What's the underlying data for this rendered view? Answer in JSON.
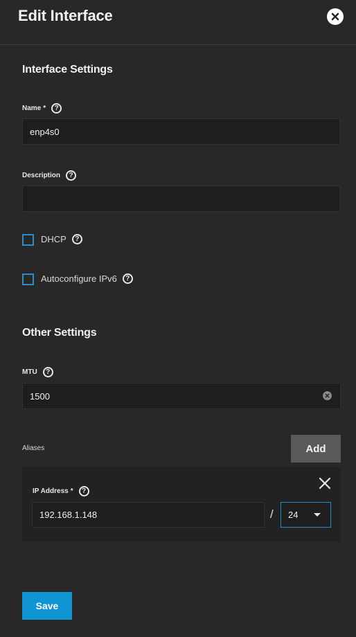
{
  "dialog": {
    "title": "Edit Interface"
  },
  "interface_settings": {
    "heading": "Interface Settings",
    "name": {
      "label": "Name",
      "required_mark": "*",
      "value": "enp4s0"
    },
    "description": {
      "label": "Description",
      "value": ""
    },
    "dhcp": {
      "label": "DHCP",
      "checked": false
    },
    "autoconfig_ipv6": {
      "label": "Autoconfigure IPv6",
      "checked": false
    }
  },
  "other_settings": {
    "heading": "Other Settings",
    "mtu": {
      "label": "MTU",
      "value": "1500"
    }
  },
  "aliases": {
    "label": "Aliases",
    "add_label": "Add",
    "items": [
      {
        "ip_label": "IP Address",
        "required_mark": "*",
        "ip_value": "192.168.1.148",
        "separator": "/",
        "netmask": "24"
      }
    ]
  },
  "actions": {
    "save_label": "Save"
  },
  "icons": {
    "help": "?",
    "close": "close-icon",
    "clear": "clear-icon"
  },
  "colors": {
    "background": "#282828",
    "accent": "#0f95d3",
    "checkbox_border": "#2a8ecb",
    "field_bg": "#1e1e1e"
  }
}
